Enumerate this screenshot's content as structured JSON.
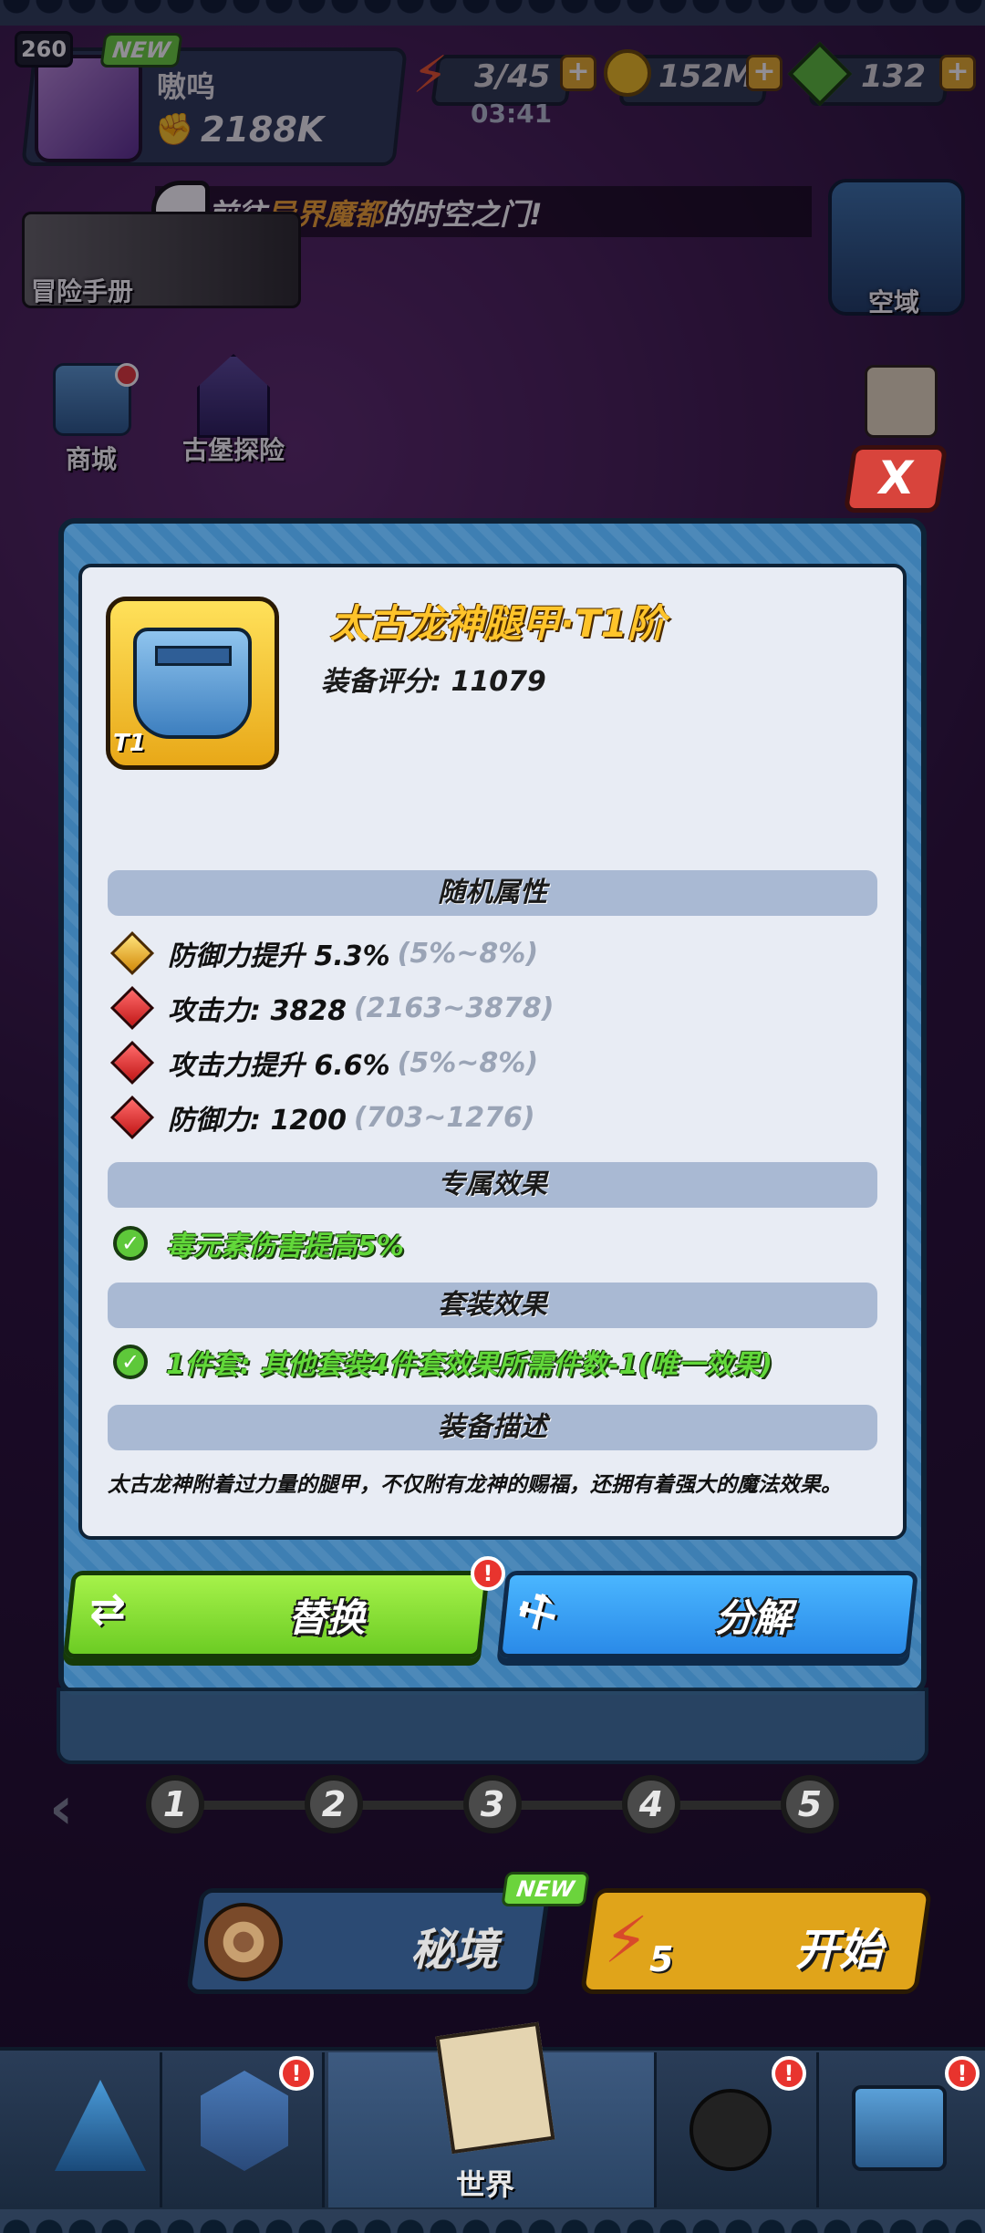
{
  "player": {
    "level": "260",
    "new_tag": "NEW",
    "name": "嗷呜",
    "power": "2188K"
  },
  "resources": {
    "energy": "3/45",
    "energy_timer": "03:41",
    "coins": "152M",
    "gems": "132",
    "plus": "+"
  },
  "announcement": {
    "prefix": "前往",
    "highlight": "异界魔都",
    "suffix": "的时空之门!"
  },
  "side_buttons": {
    "adventure_manual": "冒险手册",
    "space_domain": "空域",
    "shop": "商城",
    "castle_explore": "古堡探险"
  },
  "modal": {
    "close": "X",
    "item_name": "太古龙神腿甲·T1阶",
    "tier_tag": "T1",
    "score_label": "装备评分: 11079",
    "sections": {
      "random_attrs": "随机属性",
      "exclusive_effect": "专属效果",
      "set_effect": "套装效果",
      "description": "装备描述"
    },
    "stats": [
      {
        "gem": "gold",
        "main": "防御力提升 5.3%",
        "range": "(5%~8%)"
      },
      {
        "gem": "red",
        "main": "攻击力: 3828",
        "range": "(2163~3878)"
      },
      {
        "gem": "red",
        "main": "攻击力提升 6.6%",
        "range": "(5%~8%)"
      },
      {
        "gem": "red",
        "main": "防御力: 1200",
        "range": "(703~1276)"
      }
    ],
    "exclusive_text": "毒元素伤害提高5%",
    "set_text": "1件套: 其他套装4件套效果所需件数-1(唯一效果)",
    "description_text": "太古龙神附着过力量的腿甲，不仅附有龙神的赐福，还拥有着强大的魔法效果。",
    "replace_label": "替换",
    "split_label": "分解",
    "alert_mark": "!"
  },
  "stages": [
    "1",
    "2",
    "3",
    "4",
    "5"
  ],
  "bottom_actions": {
    "secret_realm": "秘境",
    "new_tag": "NEW",
    "start": "开始",
    "energy_cost": "5"
  },
  "nav": {
    "world": "世界",
    "alert_mark": "!"
  },
  "colors": {
    "item_name": "#ffc42a",
    "effect_green": "#62d83a",
    "replace_green": "#8ee03a",
    "split_blue": "#3aa0f4",
    "panel_blue": "#3e7fb3"
  }
}
